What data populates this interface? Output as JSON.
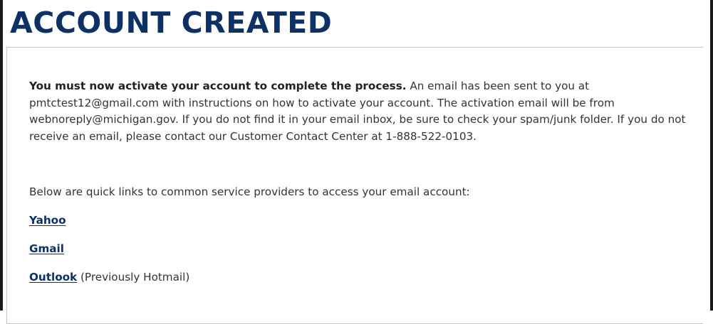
{
  "page": {
    "title": "ACCOUNT CREATED"
  },
  "message": {
    "bold_lead": "You must now activate your account to complete the process.",
    "body": " An email has been sent to you at pmtctest12@gmail.com with instructions on how to activate your account. The activation email will be from webnoreply@michigan.gov. If you do not find it in your email inbox, be sure to check your spam/junk folder. If you do not receive an email, please contact our Customer Contact Center at 1-888-522-0103."
  },
  "quick_links": {
    "intro": "Below are quick links to common service providers to access your email account:",
    "yahoo_label": "Yahoo",
    "gmail_label": "Gmail",
    "outlook_label": "Outlook",
    "outlook_note": " (Previously Hotmail)"
  },
  "colors": {
    "title": "#0d3165",
    "link": "#0d3165",
    "body_text": "#333333",
    "box_border": "#c7c7c7"
  }
}
